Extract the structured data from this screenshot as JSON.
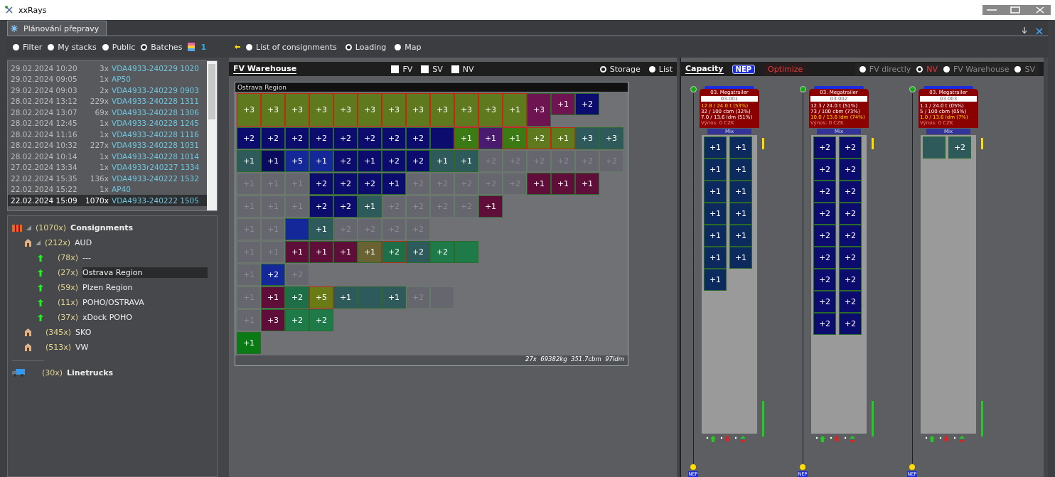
{
  "window": {
    "title": "xxRays"
  },
  "tab": {
    "label": "Plánování přepravy"
  },
  "left_modes": [
    {
      "label": "Filter",
      "selected": false
    },
    {
      "label": "My stacks",
      "selected": false
    },
    {
      "label": "Public",
      "selected": false
    },
    {
      "label": "Batches",
      "selected": true
    }
  ],
  "batch_count": "1",
  "views": [
    {
      "label": "List of consignments",
      "selected": false
    },
    {
      "label": "Loading",
      "selected": true
    },
    {
      "label": "Map",
      "selected": false
    }
  ],
  "batches": [
    {
      "date": "29.02.2024 10:20",
      "count": "3x",
      "name": "VDA4933-240229 1020",
      "selected": false
    },
    {
      "date": "29.02.2024 09:05",
      "count": "1x",
      "name": "AP50",
      "selected": false
    },
    {
      "date": "29.02.2024 09:03",
      "count": "2x",
      "name": "VDA4933-240229 0903",
      "selected": false
    },
    {
      "date": "28.02.2024 13:12",
      "count": "229x",
      "name": "VDA4933-240228 1311",
      "selected": false
    },
    {
      "date": "28.02.2024 13:07",
      "count": "69x",
      "name": "VDA4933-240228 1306",
      "selected": false
    },
    {
      "date": "28.02.2024 12:45",
      "count": "1x",
      "name": "VDA4933-240228 1245",
      "selected": false
    },
    {
      "date": "28.02.2024 11:16",
      "count": "1x",
      "name": "VDA4933-240228 1116",
      "selected": false
    },
    {
      "date": "28.02.2024 10:32",
      "count": "227x",
      "name": "VDA4933-240228 1031",
      "selected": false
    },
    {
      "date": "28.02.2024 10:14",
      "count": "1x",
      "name": "VDA4933-240228 1014",
      "selected": false
    },
    {
      "date": "27.02.2024 13:34",
      "count": "1x",
      "name": "VDA4933r240227 1334",
      "selected": false
    },
    {
      "date": "22.02.2024 15:35",
      "count": "136x",
      "name": "VDA4933-240222 1532",
      "selected": false
    },
    {
      "date": "22.02.2024 15:22",
      "count": "1x",
      "name": "AP40",
      "selected": false
    },
    {
      "date": "22.02.2024 15:09",
      "count": "1070x",
      "name": "VDA4933-240222 1505",
      "selected": true
    }
  ],
  "tree": [
    {
      "kind": "consignments",
      "count": "(1070x)",
      "label": "Consignments",
      "expanded": true,
      "selected": false,
      "children": [
        {
          "kind": "depot",
          "count": "(212x)",
          "label": "AUD",
          "expanded": true,
          "selected": false,
          "children": [
            {
              "kind": "region",
              "count": "(78x)",
              "label": "---",
              "selected": false
            },
            {
              "kind": "region",
              "count": "(27x)",
              "label": "Ostrava Region",
              "selected": true
            },
            {
              "kind": "region",
              "count": "(59x)",
              "label": "Plzen Region",
              "selected": false
            },
            {
              "kind": "region",
              "count": "(11x)",
              "label": "POHO/OSTRAVA",
              "selected": false
            },
            {
              "kind": "region",
              "count": "(37x)",
              "label": "xDock POHO",
              "selected": false
            }
          ]
        },
        {
          "kind": "depot",
          "count": "(345x)",
          "label": "SKO",
          "selected": false
        },
        {
          "kind": "depot",
          "count": "(513x)",
          "label": "VW",
          "selected": false
        }
      ]
    }
  ],
  "linetrucks": {
    "count": "(30x)",
    "label": "Linetrucks"
  },
  "warehouse": {
    "title": "FV Warehouse",
    "filters": [
      {
        "label": "FV",
        "checked": false
      },
      {
        "label": "SV",
        "checked": false
      },
      {
        "label": "NV",
        "checked": false
      }
    ],
    "modes": [
      {
        "label": "Storage",
        "selected": true
      },
      {
        "label": "List",
        "selected": false
      }
    ],
    "region": "Ostrava Region",
    "rows": [
      [
        {
          "label": "+3",
          "color": "#5f7a1e",
          "tall": true,
          "flagged": true
        },
        {
          "label": "+3",
          "color": "#5f7a1e",
          "tall": true,
          "flagged": true
        },
        {
          "label": "+3",
          "color": "#5f7a1e",
          "tall": true,
          "flagged": true
        },
        {
          "label": "+3",
          "color": "#5f7a1e",
          "tall": true,
          "flagged": true
        },
        {
          "label": "+3",
          "color": "#5f7a1e",
          "tall": true,
          "flagged": true
        },
        {
          "label": "+3",
          "color": "#5f7a1e",
          "tall": true,
          "flagged": true
        },
        {
          "label": "+3",
          "color": "#5f7a1e",
          "tall": true,
          "flagged": true
        },
        {
          "label": "+3",
          "color": "#5f7a1e",
          "tall": true,
          "flagged": true
        },
        {
          "label": "+3",
          "color": "#5f7a1e",
          "tall": true,
          "flagged": true
        },
        {
          "label": "+3",
          "color": "#5f7a1e",
          "tall": true,
          "flagged": true
        },
        {
          "label": "+3",
          "color": "#5f7a1e",
          "tall": true,
          "flagged": true
        },
        {
          "label": "+1",
          "color": "#5f7a1e",
          "tall": true,
          "flagged": true
        },
        {
          "label": "+3",
          "color": "#6e1450",
          "tall": true
        },
        {
          "label": "+1",
          "color": "#6e1450"
        },
        {
          "label": "+2",
          "color": "#0c0c6e"
        }
      ],
      [
        {
          "label": "+2",
          "color": "#0c0c6e"
        },
        {
          "label": "+2",
          "color": "#0c0c6e"
        },
        {
          "label": "+2",
          "color": "#0c0c6e"
        },
        {
          "label": "+2",
          "color": "#0c0c6e"
        },
        {
          "label": "+2",
          "color": "#0c0c6e"
        },
        {
          "label": "+2",
          "color": "#0c0c6e"
        },
        {
          "label": "+2",
          "color": "#0c0c6e"
        },
        {
          "label": "+2",
          "color": "#0c0c6e"
        },
        {
          "color": "#0c0c6e"
        },
        {
          "label": "+1",
          "color": "#3c7a14",
          "flagged": true
        },
        {
          "label": "+1",
          "color": "#4a1a6e"
        },
        {
          "label": "+1",
          "color": "#3c7a14",
          "flagged": true
        },
        {
          "label": "+2",
          "color": "#5f7a1e",
          "flagged": true
        },
        {
          "label": "+1",
          "color": "#5f7a1e",
          "flagged": true
        },
        {
          "label": "+3",
          "color": "#2f5a5c"
        },
        {
          "label": "+3",
          "color": "#2f5a5c"
        }
      ],
      [
        {
          "label": "+1",
          "color": "#2f5a5c"
        },
        {
          "label": "+1",
          "color": "#0a0a5e"
        },
        {
          "label": "+5",
          "color": "#14289a"
        },
        {
          "label": "+1",
          "color": "#14289a"
        },
        {
          "label": "+2",
          "color": "#0c0c6e"
        },
        {
          "label": "+1",
          "color": "#0c0c6e"
        },
        {
          "label": "+2",
          "color": "#0c0c6e"
        },
        {
          "label": "+2",
          "color": "#0c0c6e"
        },
        {
          "label": "+1",
          "color": "#2f5a5c"
        },
        {
          "label": "+1",
          "color": "#2f5a5c"
        },
        {
          "label": "+2",
          "dim": true
        },
        {
          "label": "+2",
          "dim": true
        },
        {
          "label": "+2",
          "dim": true
        },
        {
          "label": "+2",
          "dim": true
        },
        {
          "label": "+2",
          "dim": true
        },
        {
          "label": "+2",
          "dim": true
        }
      ],
      [
        {
          "label": "+1",
          "dim": true
        },
        {
          "label": "+1",
          "dim": true
        },
        {
          "label": "+1",
          "dim": true
        },
        {
          "label": "+2",
          "color": "#0c0c6e"
        },
        {
          "label": "+2",
          "color": "#0c0c6e"
        },
        {
          "label": "+2",
          "color": "#0c0c6e"
        },
        {
          "label": "+1",
          "color": "#0c0c6e"
        },
        {
          "label": "+2",
          "dim": true
        },
        {
          "label": "+2",
          "dim": true
        },
        {
          "label": "+2",
          "dim": true
        },
        {
          "label": "+2",
          "dim": true
        },
        {
          "label": "+2",
          "dim": true
        },
        {
          "label": "+1",
          "color": "#5e0e38"
        },
        {
          "label": "+1",
          "color": "#5e0e38"
        },
        {
          "label": "+1",
          "color": "#5e0e38"
        }
      ],
      [
        {
          "label": "+1",
          "dim": true
        },
        {
          "label": "+1",
          "dim": true
        },
        {
          "label": "+1",
          "dim": true
        },
        {
          "label": "+2",
          "color": "#0c0c6e"
        },
        {
          "label": "+2",
          "color": "#0c0c6e"
        },
        {
          "label": "+1",
          "color": "#2f5a5c"
        },
        {
          "label": "+2",
          "dim": true
        },
        {
          "label": "+2",
          "dim": true
        },
        {
          "label": "+2",
          "dim": true
        },
        {
          "label": "+2",
          "dim": true
        },
        {
          "label": "+1",
          "color": "#5e0e38"
        }
      ],
      [
        {
          "label": "+1",
          "dim": true
        },
        {
          "label": "+1",
          "dim": true
        },
        {
          "color": "#14289a"
        },
        {
          "label": "+1",
          "color": "#2f5a5c"
        },
        {
          "label": "+2",
          "dim": true
        },
        {
          "label": "+2",
          "dim": true
        },
        {
          "label": "+2",
          "dim": true
        },
        {
          "label": "+2",
          "dim": true
        }
      ],
      [
        {
          "label": "+1",
          "dim": true
        },
        {
          "label": "+1",
          "dim": true
        },
        {
          "label": "+1",
          "color": "#5e0e38"
        },
        {
          "label": "+1",
          "color": "#5e0e38"
        },
        {
          "label": "+1",
          "color": "#5e0e38"
        },
        {
          "label": "+1",
          "color": "#6a6232"
        },
        {
          "label": "+2",
          "color": "#1e6e48",
          "flagged": true
        },
        {
          "label": "+2",
          "color": "#2f5a5c"
        },
        {
          "label": "+2",
          "color": "#1e7a48"
        },
        {
          "color": "#1e7a48"
        }
      ],
      [
        {
          "label": "+1",
          "dim": true
        },
        {
          "label": "+2",
          "color": "#14289a"
        },
        {
          "label": "+2",
          "dim": true
        }
      ],
      [
        {
          "label": "+1",
          "dim": true
        },
        {
          "label": "+1",
          "color": "#5e0e38"
        },
        {
          "label": "+2",
          "color": "#1e6e48"
        },
        {
          "label": "+5",
          "color": "#6a7a14",
          "flagged": true
        },
        {
          "label": "+1",
          "color": "#2f5a5c"
        },
        {
          "color": "#2f5a5c"
        },
        {
          "label": "+1",
          "color": "#2f5a5c"
        },
        {
          "label": "+2",
          "dim": true
        },
        {
          "dim": true
        }
      ],
      [
        {
          "label": "+1",
          "dim": true
        },
        {
          "label": "+3",
          "color": "#5e0e38"
        },
        {
          "label": "+2",
          "color": "#1e7a48"
        },
        {
          "label": "+2",
          "color": "#1e7a48"
        }
      ],
      [
        {
          "label": "+1",
          "color": "#0a7a14"
        }
      ]
    ],
    "summary": "27x  69382kg  351.7cbm  97ldm"
  },
  "capacity": {
    "title": "Capacity",
    "nep": "NEP",
    "optimize": "Optimize",
    "modes": [
      {
        "label": "FV directly",
        "selected": false
      },
      {
        "label": "NV",
        "selected": true
      },
      {
        "label": "FV Warehouse",
        "selected": false
      },
      {
        "label": "SV",
        "selected": false
      }
    ],
    "trailers": [
      {
        "type": "03. Megatrailer",
        "id": "03.001",
        "stats": [
          {
            "text": "12.8 / 24.0 t  (53%)",
            "highlight": true
          },
          {
            "text": "32 / 100 cbm  (32%)",
            "highlight": false
          },
          {
            "text": "7.0 / 13.6 ldm  (51%)",
            "highlight": false
          }
        ],
        "revenue": "Výnos: 0 CZK",
        "mix": "Mix",
        "badge": "NEP",
        "cells": [
          {
            "label": "+1",
            "color": "#0c2a5e"
          },
          {
            "label": "+1",
            "color": "#0c2a5e"
          },
          {
            "label": "+1",
            "color": "#0c2a5e"
          },
          {
            "label": "+1",
            "color": "#0c2a5e"
          },
          {
            "label": "+1",
            "color": "#0c2a5e"
          },
          {
            "label": "+1",
            "color": "#0c2a5e"
          },
          {
            "label": "+1",
            "color": "#0c2a5e"
          },
          {
            "label": "+1",
            "color": "#0c2a5e"
          },
          {
            "label": "+1",
            "color": "#0c2a5e"
          },
          {
            "label": "+1",
            "color": "#0c2a5e"
          },
          {
            "label": "+1",
            "color": "#0c2a5e"
          },
          {
            "label": "+1",
            "color": "#0c2a5e"
          },
          {
            "label": "+1",
            "color": "#0c2a5e"
          }
        ]
      },
      {
        "type": "03. Megatrailer",
        "id": "03.002",
        "stats": [
          {
            "text": "12.3 / 24.0 t  (51%)",
            "highlight": false
          },
          {
            "text": "73 / 100 cbm  (73%)",
            "highlight": false
          },
          {
            "text": "10.0 / 13.6 ldm  (74%)",
            "highlight": true
          }
        ],
        "revenue": "Výnos: 0 CZK",
        "mix": "Mix",
        "badge": "NEP",
        "cells": [
          {
            "label": "+2",
            "color": "#0c0c6e"
          },
          {
            "label": "+2",
            "color": "#0c0c6e"
          },
          {
            "label": "+2",
            "color": "#0c0c6e"
          },
          {
            "label": "+2",
            "color": "#0c0c6e"
          },
          {
            "label": "+2",
            "color": "#0c0c6e"
          },
          {
            "label": "+2",
            "color": "#0c0c6e"
          },
          {
            "label": "+2",
            "color": "#0c0c6e"
          },
          {
            "label": "+2",
            "color": "#0c0c6e"
          },
          {
            "label": "+2",
            "color": "#0c0c6e"
          },
          {
            "label": "+2",
            "color": "#0c0c6e"
          },
          {
            "label": "+2",
            "color": "#0c0c6e"
          },
          {
            "label": "+2",
            "color": "#0c0c6e"
          },
          {
            "label": "+2",
            "color": "#0c0c6e"
          },
          {
            "label": "+2",
            "color": "#0c0c6e"
          },
          {
            "label": "+2",
            "color": "#0c0c6e"
          },
          {
            "label": "+2",
            "color": "#0c0c6e"
          },
          {
            "label": "+2",
            "color": "#0c0c6e"
          },
          {
            "label": "+2",
            "color": "#0c0c6e"
          }
        ]
      },
      {
        "type": "03. Megatrailer",
        "id": "03.003",
        "stats": [
          {
            "text": "1.1 / 24.0 t  (05%)",
            "highlight": false
          },
          {
            "text": "5 / 100 cbm  (05%)",
            "highlight": false
          },
          {
            "text": "1.0 / 13.6 ldm  (7%)",
            "highlight": true
          }
        ],
        "revenue": "Výnos: 0 CZK",
        "mix": "Mix",
        "badge": "NEP",
        "cells": [
          {
            "color": "#2f5a5c"
          },
          {
            "label": "+2",
            "color": "#2f5a5c"
          }
        ]
      }
    ]
  }
}
